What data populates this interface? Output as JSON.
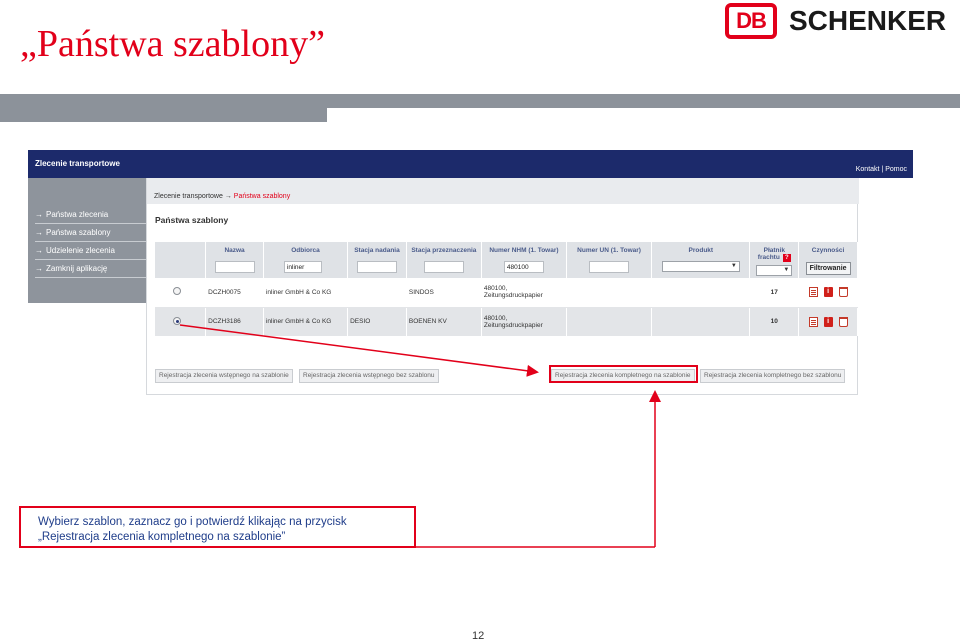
{
  "slide": {
    "title": "„Państwa szablony”",
    "page_number": "12",
    "callout_line1": "Wybierz szablon, zaznacz go i potwierdź klikając na przycisk",
    "callout_line2": "„Rejestracja zlecenia kompletnego na szablonie”"
  },
  "logo": {
    "mark": "DB",
    "wordmark": "SCHENKER"
  },
  "app": {
    "title": "Zlecenie transportowe",
    "header_links": [
      "Kontakt",
      "Pomoc"
    ],
    "breadcrumb": [
      "Zlecenie transportowe",
      "Państwa szablony"
    ],
    "section_title": "Państwa szablony",
    "sidebar": [
      {
        "label": "Państwa zlecenia",
        "active": false
      },
      {
        "label": "Państwa szablony",
        "active": true
      },
      {
        "label": "Udzielenie zlecenia",
        "active": false
      },
      {
        "label": "Zamknij aplikację",
        "active": false
      }
    ],
    "colors": {
      "accent": "#e2001a",
      "header": "#1c2a6b",
      "sidebar": "#8e949c"
    }
  },
  "table": {
    "headers": {
      "nazwa": "Nazwa",
      "odbiorca": "Odbiorca",
      "stacja_nadania": "Stacja nadania",
      "stacja_przeznaczenia": "Stacja przeznaczenia",
      "nhm": "Numer NHM (1. Towar)",
      "un": "Numer UN (1. Towar)",
      "produkt": "Produkt",
      "platnik": "Płatnik frachtu",
      "platnik_help": "?",
      "czynnosci": "Czynności"
    },
    "filters": {
      "nazwa": "",
      "odbiorca": "inliner",
      "stacja_nadania": "",
      "stacja_przeznaczenia": "",
      "nhm": "480100",
      "un": ""
    },
    "filter_button": "Filtrowanie",
    "rows": [
      {
        "selected": false,
        "nazwa": "DCZH0075",
        "odbiorca": "inliner GmbH & Co KG",
        "stacja_nadania": "",
        "stacja_przeznaczenia": "SINDOS",
        "nhm_code": "480100,",
        "nhm_desc": "Zeitungsdruckpapier",
        "un": "",
        "produkt": "",
        "platnik": "17"
      },
      {
        "selected": true,
        "nazwa": "DCZH3186",
        "odbiorca": "inliner GmbH & Co KG",
        "stacja_nadania": "DESIO",
        "stacja_przeznaczenia": "BOENEN KV",
        "nhm_code": "480100,",
        "nhm_desc": "Zeitungsdruckpapier",
        "un": "",
        "produkt": "",
        "platnik": "10"
      }
    ],
    "row_icons": [
      "edit-icon",
      "info-icon",
      "trash-icon"
    ]
  },
  "buttons": {
    "b1": "Rejestracja zlecenia wstępnego na szablonie",
    "b2": "Rejestracja zlecenia wstępnego bez szablonu",
    "b3": "Rejestracja zlecenia kompletnego na szablonie",
    "b4": "Rejestracja zlecenia kompletnego bez szablonu"
  }
}
